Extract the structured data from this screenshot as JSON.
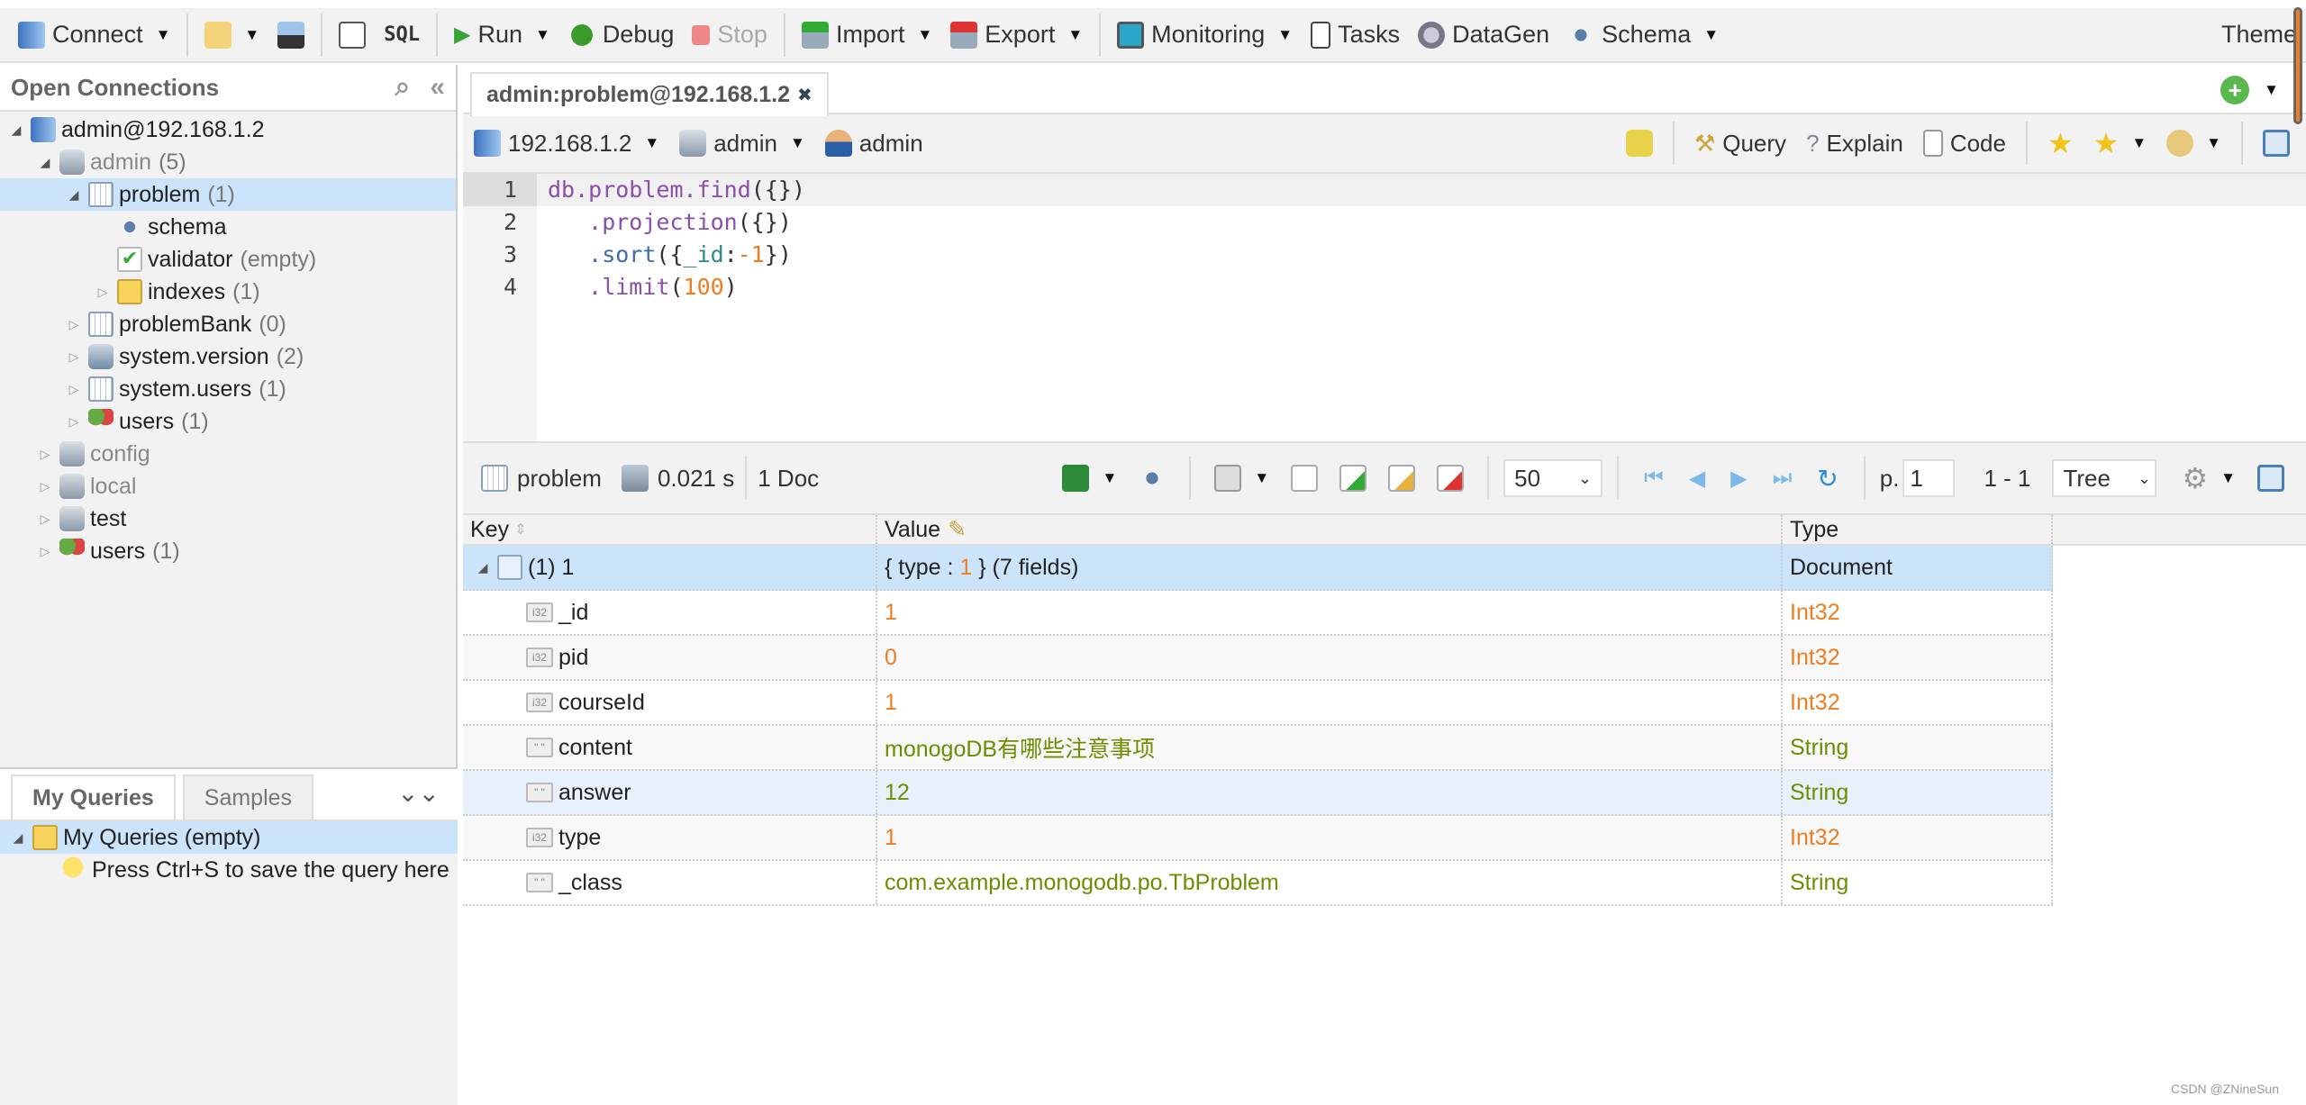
{
  "toolbar": {
    "connect": "Connect",
    "sql": "SQL",
    "run": "Run",
    "debug": "Debug",
    "stop": "Stop",
    "import": "Import",
    "export": "Export",
    "monitoring": "Monitoring",
    "tasks": "Tasks",
    "datagen": "DataGen",
    "schema": "Schema",
    "theme": "Theme"
  },
  "sidebar": {
    "title": "Open Connections",
    "tree": [
      {
        "label": "admin@192.168.1.2",
        "count": "",
        "icon": "server-icon",
        "level": 0,
        "state": "expanded"
      },
      {
        "label": "admin",
        "count": "(5)",
        "icon": "database-icon",
        "level": 1,
        "state": "expanded",
        "muted": true
      },
      {
        "label": "problem",
        "count": "(1)",
        "icon": "collection-icon",
        "level": 2,
        "state": "expanded",
        "selected": true
      },
      {
        "label": "schema",
        "count": "",
        "icon": "schema-icon",
        "level": 3,
        "state": "leaf"
      },
      {
        "label": "validator",
        "count": "(empty)",
        "icon": "validator-icon",
        "level": 3,
        "state": "leaf"
      },
      {
        "label": "indexes",
        "count": "(1)",
        "icon": "folder-icon",
        "level": 3,
        "state": "collapsed"
      },
      {
        "label": "problemBank",
        "count": "(0)",
        "icon": "collection-icon",
        "level": 2,
        "state": "collapsed"
      },
      {
        "label": "system.version",
        "count": "(2)",
        "icon": "system-collection-icon",
        "level": 2,
        "state": "collapsed"
      },
      {
        "label": "system.users",
        "count": "(1)",
        "icon": "collection-icon",
        "level": 2,
        "state": "collapsed"
      },
      {
        "label": "users",
        "count": "(1)",
        "icon": "users-icon",
        "level": 2,
        "state": "collapsed"
      },
      {
        "label": "config",
        "count": "",
        "icon": "database-icon",
        "level": 1,
        "state": "collapsed",
        "muted": true
      },
      {
        "label": "local",
        "count": "",
        "icon": "database-icon",
        "level": 1,
        "state": "collapsed",
        "muted": true
      },
      {
        "label": "test",
        "count": "",
        "icon": "database-icon",
        "level": 1,
        "state": "collapsed"
      },
      {
        "label": "users",
        "count": "(1)",
        "icon": "users-icon",
        "level": 1,
        "state": "collapsed"
      }
    ]
  },
  "queries_panel": {
    "tabs": [
      "My Queries",
      "Samples"
    ],
    "active_tab": "My Queries",
    "folder": "My Queries (empty)",
    "hint": "Press Ctrl+S to save the query here"
  },
  "editor_tab": {
    "title": "admin:problem@192.168.1.2"
  },
  "connection_bar": {
    "host": "192.168.1.2",
    "database": "admin",
    "user": "admin",
    "query": "Query",
    "explain": "Explain",
    "code": "Code"
  },
  "editor": {
    "lines": [
      {
        "n": "1",
        "tokens": [
          [
            "db.problem.find",
            "k-p"
          ],
          [
            "(",
            "k-d"
          ],
          [
            "{}",
            "k-d"
          ],
          [
            ")",
            "k-d"
          ]
        ]
      },
      {
        "n": "2",
        "tokens": [
          [
            "   .projection",
            "k-p"
          ],
          [
            "({})",
            "k-d"
          ]
        ]
      },
      {
        "n": "3",
        "tokens": [
          [
            "   .sort",
            "k-b"
          ],
          [
            "({",
            "k-d"
          ],
          [
            "_id",
            "k-t"
          ],
          [
            ":",
            "k-d"
          ],
          [
            "-1",
            "k-o"
          ],
          [
            "})",
            "k-d"
          ]
        ]
      },
      {
        "n": "4",
        "tokens": [
          [
            "   .limit",
            "k-p"
          ],
          [
            "(",
            "k-d"
          ],
          [
            "100",
            "k-o"
          ],
          [
            ")",
            "k-d"
          ]
        ]
      }
    ]
  },
  "results_toolbar": {
    "collection": "problem",
    "time": "0.021 s",
    "docs": "1 Doc",
    "page_size": "50",
    "page_label": "p.",
    "page": "1",
    "range": "1 - 1",
    "view": "Tree"
  },
  "table": {
    "headers": [
      "Key",
      "Value",
      "Type"
    ],
    "rows": [
      {
        "key": "(1) 1",
        "value_prefix": "{ type : ",
        "value_num": "1",
        "value_suffix": " } (7 fields)",
        "type": "Document",
        "kind": "doc"
      },
      {
        "key": "_id",
        "value": "1",
        "type": "Int32",
        "kind": "int"
      },
      {
        "key": "pid",
        "value": "0",
        "type": "Int32",
        "kind": "int"
      },
      {
        "key": "courseId",
        "value": "1",
        "type": "Int32",
        "kind": "int"
      },
      {
        "key": "content",
        "value": "monogoDB有哪些注意事项",
        "type": "String",
        "kind": "str"
      },
      {
        "key": "answer",
        "value": "12",
        "type": "String",
        "kind": "str"
      },
      {
        "key": "type",
        "value": "1",
        "type": "Int32",
        "kind": "int"
      },
      {
        "key": "_class",
        "value": "com.example.monogodb.po.TbProblem",
        "type": "String",
        "kind": "str"
      }
    ]
  },
  "watermark": "CSDN @ZNineSun",
  "colors": {
    "int": "#f07c21",
    "string": "#6b8e00",
    "selection": "#cce4fa"
  }
}
